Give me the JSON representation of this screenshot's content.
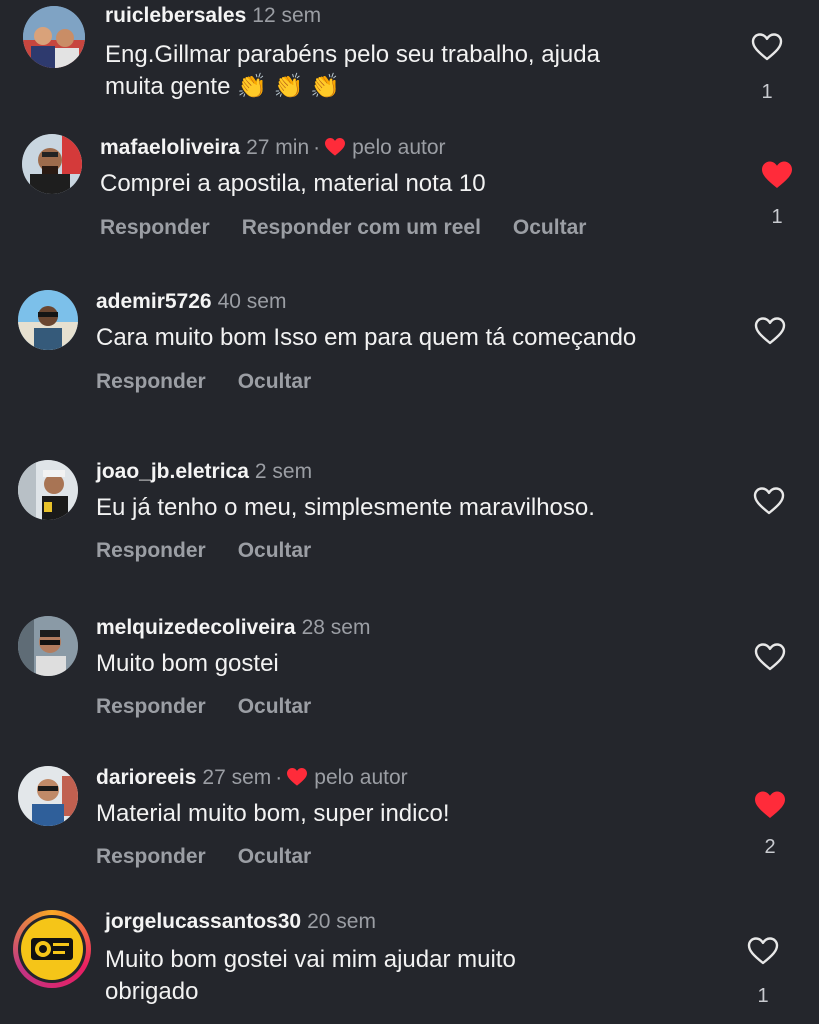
{
  "actions": {
    "reply": "Responder",
    "reply_reel": "Responder com um reel",
    "hide": "Ocultar"
  },
  "author_badge": "pelo autor",
  "colors": {
    "background": "#24262c",
    "muted_text": "#9b9ea4",
    "heart_liked": "#ff2b3a"
  },
  "comments": [
    {
      "username": "ruiclebersales",
      "time": "12 sem",
      "text": "Eng.Gillmar parabéns pelo seu trabalho, ajuda\nmuita gente 👏 👏 👏",
      "likes": "1",
      "liked_by_author": false,
      "icon": "heart-outline-icon"
    },
    {
      "username": "mafaeloliveira",
      "time": "27 min",
      "text": "Comprei a apostila, material nota 10",
      "likes": "1",
      "liked_by_author": true,
      "icon": "heart-filled-icon"
    },
    {
      "username": "ademir5726",
      "time": "40 sem",
      "text": "Cara muito bom Isso em para quem tá começando",
      "likes": "",
      "liked_by_author": false,
      "icon": "heart-outline-icon"
    },
    {
      "username": "joao_jb.eletrica",
      "time": "2 sem",
      "text": "Eu já tenho o meu, simplesmente maravilhoso.",
      "likes": "",
      "liked_by_author": false,
      "icon": "heart-outline-icon"
    },
    {
      "username": "melquizedecoliveira",
      "time": "28 sem",
      "text": "Muito bom gostei",
      "likes": "",
      "liked_by_author": false,
      "icon": "heart-outline-icon"
    },
    {
      "username": "darioreeis",
      "time": "27 sem",
      "text": "Material muito bom, super indico!",
      "likes": "2",
      "liked_by_author": true,
      "icon": "heart-filled-icon"
    },
    {
      "username": "jorgelucassantos30",
      "time": "20 sem",
      "text": "Muito bom gostei vai mim ajudar muito\nobrigado",
      "likes": "1",
      "liked_by_author": false,
      "icon": "heart-outline-icon"
    }
  ]
}
